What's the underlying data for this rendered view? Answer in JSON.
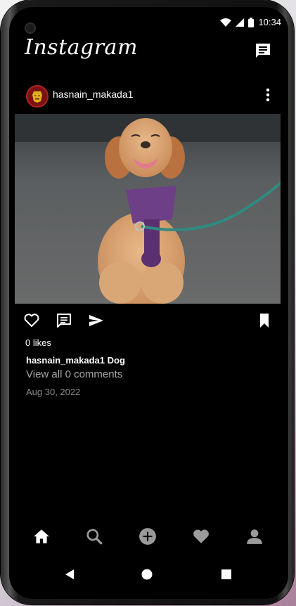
{
  "status": {
    "time": "10:34"
  },
  "app": {
    "logo": "Instagram"
  },
  "post": {
    "username": "hasnain_makada1",
    "caption_user": "hasnain_makada1",
    "caption_text": "Dog",
    "likes": "0 likes",
    "comments_link": "View all 0 comments",
    "date": "Aug 30, 2022"
  },
  "icons": {
    "direct": "message-icon",
    "more": "more-vertical-icon",
    "like": "heart-outline-icon",
    "comment": "comment-icon",
    "share": "send-icon",
    "save": "bookmark-icon",
    "nav": [
      "home-icon",
      "search-icon",
      "add-circle-icon",
      "heart-icon",
      "profile-icon"
    ]
  },
  "colors": {
    "background": "#000000",
    "text": "#ffffff",
    "muted": "#a8a8a8",
    "avatar": "#7a1212"
  }
}
